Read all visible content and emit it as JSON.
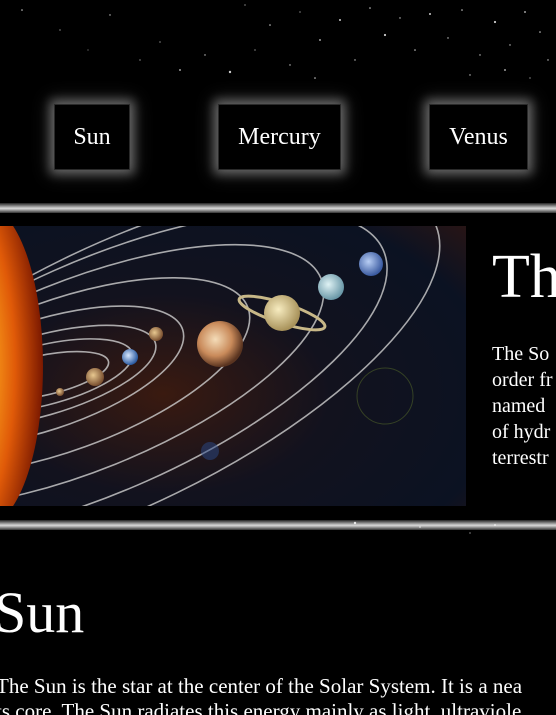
{
  "nav": {
    "items": [
      {
        "label": "Sun"
      },
      {
        "label": "Mercury"
      },
      {
        "label": "Venus"
      }
    ]
  },
  "hero": {
    "title": "Th",
    "text_lines": [
      "The So",
      "order fr",
      "named",
      "of hydr",
      "terrestr"
    ]
  },
  "section": {
    "title": "Sun",
    "text_lines": [
      "The Sun is the star at the center of the Solar System. It is a nea",
      "ts core. The Sun radiates this energy mainly as light, ultraviole"
    ]
  }
}
